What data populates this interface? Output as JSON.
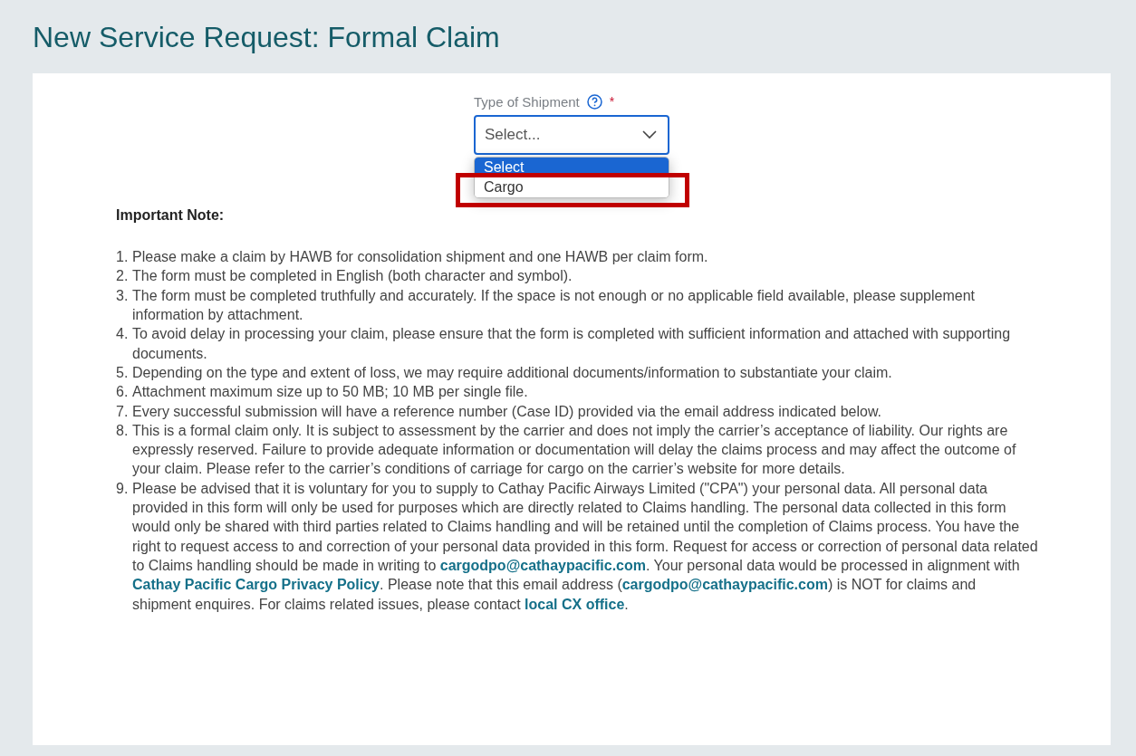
{
  "page_title": "New Service Request: Formal Claim",
  "shipment_field": {
    "label": "Type of Shipment",
    "required_mark": "*",
    "value": "Select...",
    "expanded": true,
    "options": [
      {
        "label": "Select",
        "selected": true,
        "highlighted": false
      },
      {
        "label": "Cargo",
        "selected": false,
        "highlighted": true
      }
    ]
  },
  "note": {
    "heading": "Important Note:",
    "items": [
      {
        "number": "1.",
        "segments": [
          {
            "kind": "text",
            "text": "Please make a claim by HAWB for consolidation shipment and one HAWB per claim form."
          }
        ]
      },
      {
        "number": "2.",
        "segments": [
          {
            "kind": "text",
            "text": "The form must be completed in English (both character and symbol)."
          }
        ]
      },
      {
        "number": "3.",
        "segments": [
          {
            "kind": "text",
            "text": "The form must be completed truthfully and accurately. If the space is not enough or no applicable field available, please supplement information by attachment."
          }
        ]
      },
      {
        "number": "4.",
        "segments": [
          {
            "kind": "text",
            "text": "To avoid delay in processing your claim, please ensure that the form is completed with sufficient information and attached with supporting documents."
          }
        ]
      },
      {
        "number": "5.",
        "segments": [
          {
            "kind": "text",
            "text": "Depending on the type and extent of loss, we may require additional documents/information to substantiate your claim."
          }
        ]
      },
      {
        "number": "6.",
        "segments": [
          {
            "kind": "text",
            "text": "Attachment maximum size up to 50 MB; 10 MB per single file."
          }
        ]
      },
      {
        "number": "7.",
        "segments": [
          {
            "kind": "text",
            "text": "Every successful submission will have a reference number (Case ID) provided via the email address indicated below."
          }
        ]
      },
      {
        "number": "8.",
        "segments": [
          {
            "kind": "text",
            "text": "This is a formal claim only. It is subject to assessment by the carrier and does not imply the carrier’s acceptance of liability. Our rights are expressly reserved. Failure to provide adequate information or documentation will delay the claims process and may affect the outcome of your claim. Please refer to the carrier’s conditions of carriage for cargo on the carrier’s website for more details."
          }
        ]
      },
      {
        "number": "9.",
        "segments": [
          {
            "kind": "text",
            "text": "Please be advised that it is voluntary for you to supply to Cathay Pacific Airways Limited (\"CPA\") your personal data. All personal data provided in this form will only be used for purposes which are directly related to Claims handling. The personal data collected in this form would only be shared with third parties related to Claims handling and will be retained until the completion of Claims process. You have the right to request access to and correction of your personal data provided in this form. Request for access or correction of personal data related to Claims handling should be made in writing to "
          },
          {
            "kind": "link",
            "text": "cargodpo@cathaypacific.com"
          },
          {
            "kind": "text",
            "text": ". Your personal data would be processed in alignment with "
          },
          {
            "kind": "link",
            "text": "Cathay Pacific Cargo Privacy Policy"
          },
          {
            "kind": "text",
            "text": ". Please note that this email address ("
          },
          {
            "kind": "link",
            "text": "cargodpo@cathaypacific.com"
          },
          {
            "kind": "text",
            "text": ") is NOT for claims and shipment enquires. For claims related issues, please contact "
          },
          {
            "kind": "link",
            "text": "local CX office"
          },
          {
            "kind": "text",
            "text": "."
          }
        ]
      }
    ]
  }
}
